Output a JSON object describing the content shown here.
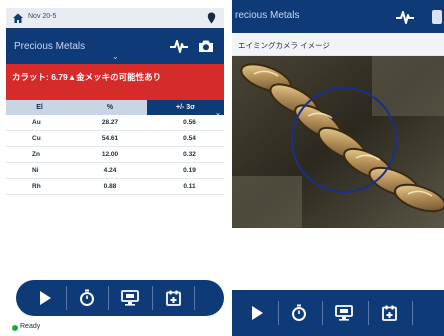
{
  "left_screen": {
    "status_bar": {
      "text": "Nov 20-5",
      "home_icon": "home-icon",
      "marker_icon": "location-marker-icon"
    },
    "header": {
      "title": "Precious Metals",
      "notch": "⌄",
      "icons": [
        "pulse-icon",
        "camera-icon"
      ]
    },
    "alert": {
      "text": "カラット: 6.79▲金メッキの可能性あり",
      "sub": ""
    },
    "table": {
      "headers": [
        "El",
        "%",
        "+/- 3σ"
      ],
      "rows": [
        {
          "el": "Au",
          "pct": "28.27",
          "err": "0.56"
        },
        {
          "el": "Cu",
          "pct": "54.61",
          "err": "0.54"
        },
        {
          "el": "Zn",
          "pct": "12.00",
          "err": "0.32"
        },
        {
          "el": "Ni",
          "pct": "4.24",
          "err": "0.19"
        },
        {
          "el": "Rh",
          "pct": "0.88",
          "err": "0.11"
        }
      ]
    },
    "toolbar": {
      "buttons": [
        "play-icon",
        "timer-icon",
        "monitor-icon",
        "calendar-add-icon"
      ]
    },
    "status": {
      "text": "Ready"
    }
  },
  "right_screen": {
    "header": {
      "title": "recious Metals",
      "icons": [
        "pulse-icon"
      ]
    },
    "camera_label": "エイミングカメラ イメージ",
    "toolbar": {
      "buttons": [
        "play-icon",
        "timer-icon",
        "monitor-icon",
        "calendar-add-icon"
      ]
    }
  },
  "colors": {
    "header_blue": "#0f3a78",
    "alert_red": "#d62b2b",
    "table_header": "#c9d4e4",
    "ready_green": "#1ea83a"
  }
}
